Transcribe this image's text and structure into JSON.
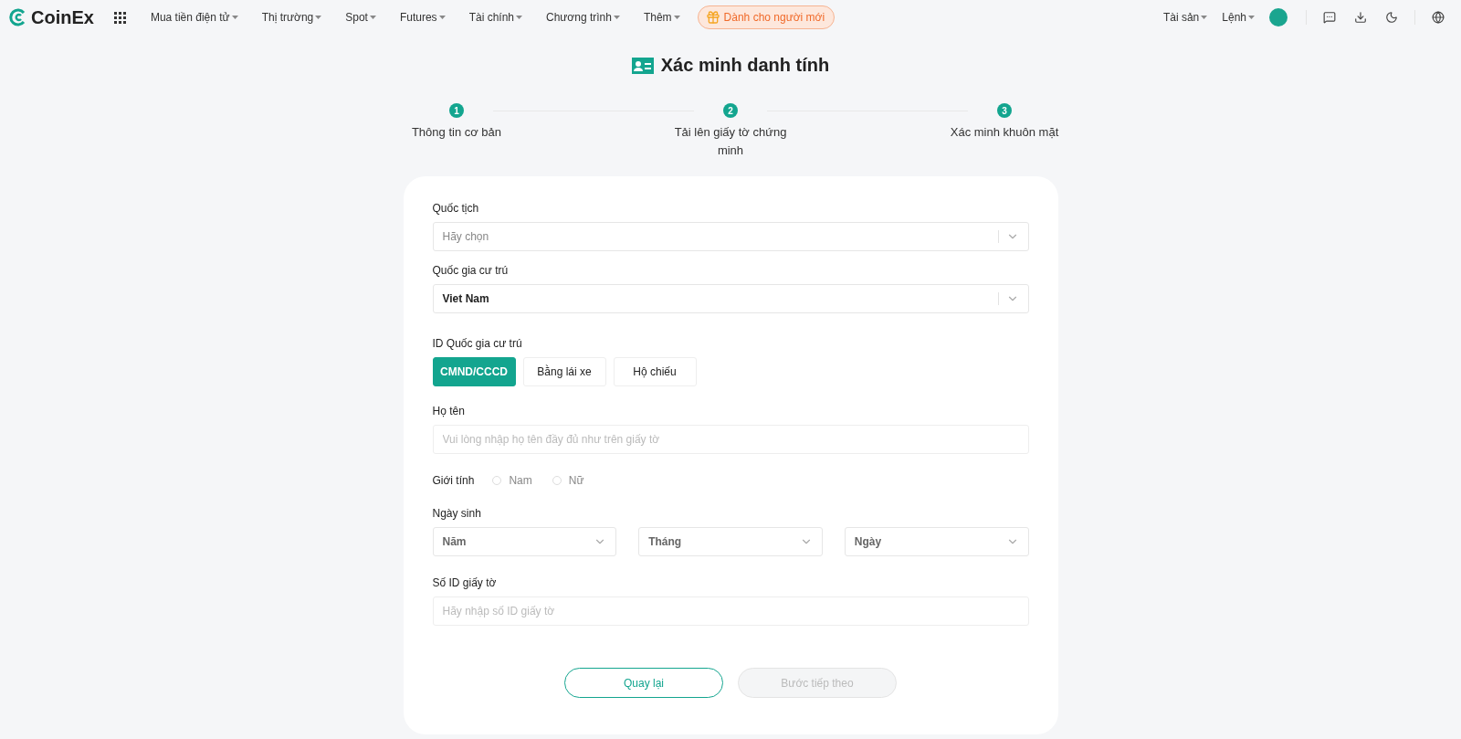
{
  "header": {
    "logo": "CoinEx",
    "menu": [
      {
        "label": "Mua tiền điện tử"
      },
      {
        "label": "Thị trường"
      },
      {
        "label": "Spot"
      },
      {
        "label": "Futures"
      },
      {
        "label": "Tài chính"
      },
      {
        "label": "Chương trình"
      },
      {
        "label": "Thêm"
      }
    ],
    "promo": "Dành cho người mới",
    "right_menu": [
      {
        "label": "Tài sản"
      },
      {
        "label": "Lệnh"
      }
    ]
  },
  "title": "Xác minh danh tính",
  "steps": [
    {
      "number": "1",
      "label": "Thông tin cơ bản"
    },
    {
      "number": "2",
      "label": "Tải lên giấy tờ chứng minh"
    },
    {
      "number": "3",
      "label": "Xác minh khuôn mặt"
    }
  ],
  "form": {
    "nationality": {
      "label": "Quốc tịch",
      "placeholder": "Hãy chọn"
    },
    "residence": {
      "label": "Quốc gia cư trú",
      "value": "Viet Nam"
    },
    "id_type": {
      "label": "ID Quốc gia cư trú",
      "options": [
        {
          "label": "CMND/CCCD",
          "selected": true
        },
        {
          "label": "Bằng lái xe",
          "selected": false
        },
        {
          "label": "Hộ chiếu",
          "selected": false
        }
      ]
    },
    "full_name": {
      "label": "Họ tên",
      "placeholder": "Vui lòng nhập họ tên đầy đủ như trên giấy tờ"
    },
    "gender": {
      "label": "Giới tính",
      "options": [
        {
          "label": "Nam",
          "checked": false
        },
        {
          "label": "Nữ",
          "checked": false
        }
      ]
    },
    "birth_date": {
      "label": "Ngày sinh",
      "selects": [
        {
          "placeholder": "Năm"
        },
        {
          "placeholder": "Tháng"
        },
        {
          "placeholder": "Ngày"
        }
      ]
    },
    "id_number": {
      "label": "Số ID giấy tờ",
      "placeholder": "Hãy nhập số ID giấy tờ"
    }
  },
  "buttons": [
    {
      "label": "Quay lại",
      "kind": "secondary",
      "disabled": false
    },
    {
      "label": "Bước tiếp theo",
      "kind": "primary",
      "disabled": true
    }
  ]
}
